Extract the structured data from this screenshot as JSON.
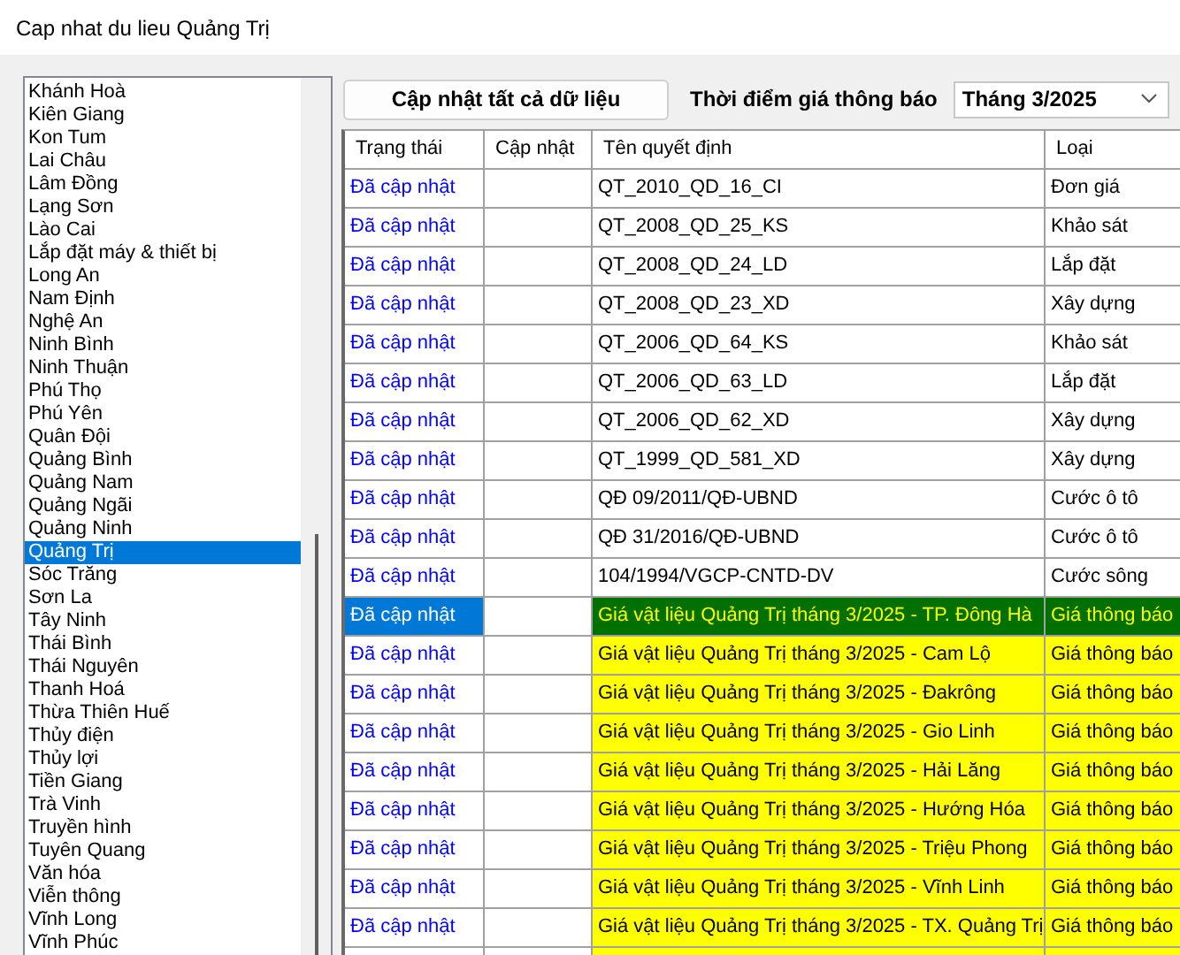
{
  "window": {
    "title": "Cap nhat du lieu Quảng Trị"
  },
  "sidebar": {
    "items": [
      {
        "label": "Khánh Hoà",
        "selected": false
      },
      {
        "label": "Kiên Giang",
        "selected": false
      },
      {
        "label": "Kon Tum",
        "selected": false
      },
      {
        "label": "Lai Châu",
        "selected": false
      },
      {
        "label": "Lâm Đồng",
        "selected": false
      },
      {
        "label": "Lạng Sơn",
        "selected": false
      },
      {
        "label": "Lào Cai",
        "selected": false
      },
      {
        "label": "Lắp đặt máy & thiết bị",
        "selected": false
      },
      {
        "label": "Long An",
        "selected": false
      },
      {
        "label": "Nam Định",
        "selected": false
      },
      {
        "label": "Nghệ An",
        "selected": false
      },
      {
        "label": "Ninh Bình",
        "selected": false
      },
      {
        "label": "Ninh Thuận",
        "selected": false
      },
      {
        "label": "Phú Thọ",
        "selected": false
      },
      {
        "label": "Phú Yên",
        "selected": false
      },
      {
        "label": "Quân Đội",
        "selected": false
      },
      {
        "label": "Quảng Bình",
        "selected": false
      },
      {
        "label": "Quảng Nam",
        "selected": false
      },
      {
        "label": "Quảng Ngãi",
        "selected": false
      },
      {
        "label": "Quảng Ninh",
        "selected": false
      },
      {
        "label": "Quảng Trị",
        "selected": true
      },
      {
        "label": "Sóc Trăng",
        "selected": false
      },
      {
        "label": "Sơn La",
        "selected": false
      },
      {
        "label": "Tây Ninh",
        "selected": false
      },
      {
        "label": "Thái Bình",
        "selected": false
      },
      {
        "label": "Thái Nguyên",
        "selected": false
      },
      {
        "label": "Thanh Hoá",
        "selected": false
      },
      {
        "label": "Thừa Thiên Huế",
        "selected": false
      },
      {
        "label": "Thủy điện",
        "selected": false
      },
      {
        "label": "Thủy lợi",
        "selected": false
      },
      {
        "label": "Tiền Giang",
        "selected": false
      },
      {
        "label": "Trà Vinh",
        "selected": false
      },
      {
        "label": "Truyền hình",
        "selected": false
      },
      {
        "label": "Tuyên Quang",
        "selected": false
      },
      {
        "label": "Văn hóa",
        "selected": false
      },
      {
        "label": "Viễn thông",
        "selected": false
      },
      {
        "label": "Vĩnh Long",
        "selected": false
      },
      {
        "label": "Vĩnh Phúc",
        "selected": false
      }
    ]
  },
  "toolbar": {
    "update_all_button": "Cập nhật tất cả dữ liệu",
    "period_label": "Thời điểm giá thông báo",
    "period_select": "Tháng 3/2025"
  },
  "table": {
    "columns": [
      "Trạng thái",
      "Cập nhật",
      "Tên quyết định",
      "Loại"
    ],
    "rows": [
      {
        "status": "Đã cập nhật",
        "name": "QT_2010_QD_16_CI",
        "type": "Đơn giá",
        "highlight": false,
        "selected": false
      },
      {
        "status": "Đã cập nhật",
        "name": "QT_2008_QD_25_KS",
        "type": "Khảo sát",
        "highlight": false,
        "selected": false
      },
      {
        "status": "Đã cập nhật",
        "name": "QT_2008_QD_24_LD",
        "type": "Lắp đặt",
        "highlight": false,
        "selected": false
      },
      {
        "status": "Đã cập nhật",
        "name": "QT_2008_QD_23_XD",
        "type": "Xây dựng",
        "highlight": false,
        "selected": false
      },
      {
        "status": "Đã cập nhật",
        "name": "QT_2006_QD_64_KS",
        "type": "Khảo sát",
        "highlight": false,
        "selected": false
      },
      {
        "status": "Đã cập nhật",
        "name": "QT_2006_QD_63_LD",
        "type": "Lắp đặt",
        "highlight": false,
        "selected": false
      },
      {
        "status": "Đã cập nhật",
        "name": "QT_2006_QD_62_XD",
        "type": "Xây dựng",
        "highlight": false,
        "selected": false
      },
      {
        "status": "Đã cập nhật",
        "name": "QT_1999_QD_581_XD",
        "type": "Xây dựng",
        "highlight": false,
        "selected": false
      },
      {
        "status": "Đã cập nhật",
        "name": "QĐ 09/2011/QĐ-UBND",
        "type": "Cước ô tô",
        "highlight": false,
        "selected": false
      },
      {
        "status": "Đã cập nhật",
        "name": "QĐ 31/2016/QĐ-UBND",
        "type": "Cước ô tô",
        "highlight": false,
        "selected": false
      },
      {
        "status": "Đã cập nhật",
        "name": "104/1994/VGCP-CNTD-DV",
        "type": "Cước sông",
        "highlight": false,
        "selected": false
      },
      {
        "status": "Đã cập nhật",
        "name": "Giá vật liệu Quảng Trị tháng 3/2025 - TP. Đông Hà",
        "type": "Giá thông báo",
        "highlight": true,
        "selected": true
      },
      {
        "status": "Đã cập nhật",
        "name": "Giá vật liệu Quảng Trị tháng 3/2025 - Cam Lộ",
        "type": "Giá thông báo",
        "highlight": true,
        "selected": false
      },
      {
        "status": "Đã cập nhật",
        "name": "Giá vật liệu Quảng Trị tháng 3/2025 - Đakrông",
        "type": "Giá thông báo",
        "highlight": true,
        "selected": false
      },
      {
        "status": "Đã cập nhật",
        "name": "Giá vật liệu Quảng Trị tháng 3/2025 - Gio Linh",
        "type": "Giá thông báo",
        "highlight": true,
        "selected": false
      },
      {
        "status": "Đã cập nhật",
        "name": "Giá vật liệu Quảng Trị tháng 3/2025 - Hải Lăng",
        "type": "Giá thông báo",
        "highlight": true,
        "selected": false
      },
      {
        "status": "Đã cập nhật",
        "name": "Giá vật liệu Quảng Trị tháng 3/2025 - Hướng Hóa",
        "type": "Giá thông báo",
        "highlight": true,
        "selected": false
      },
      {
        "status": "Đã cập nhật",
        "name": "Giá vật liệu Quảng Trị tháng 3/2025 - Triệu Phong",
        "type": "Giá thông báo",
        "highlight": true,
        "selected": false
      },
      {
        "status": "Đã cập nhật",
        "name": "Giá vật liệu Quảng Trị tháng 3/2025 - Vĩnh Linh",
        "type": "Giá thông báo",
        "highlight": true,
        "selected": false
      },
      {
        "status": "Đã cập nhật",
        "name": "Giá vật liệu Quảng Trị tháng 3/2025 - TX. Quảng Trị",
        "type": "Giá thông báo",
        "highlight": true,
        "selected": false
      }
    ]
  }
}
